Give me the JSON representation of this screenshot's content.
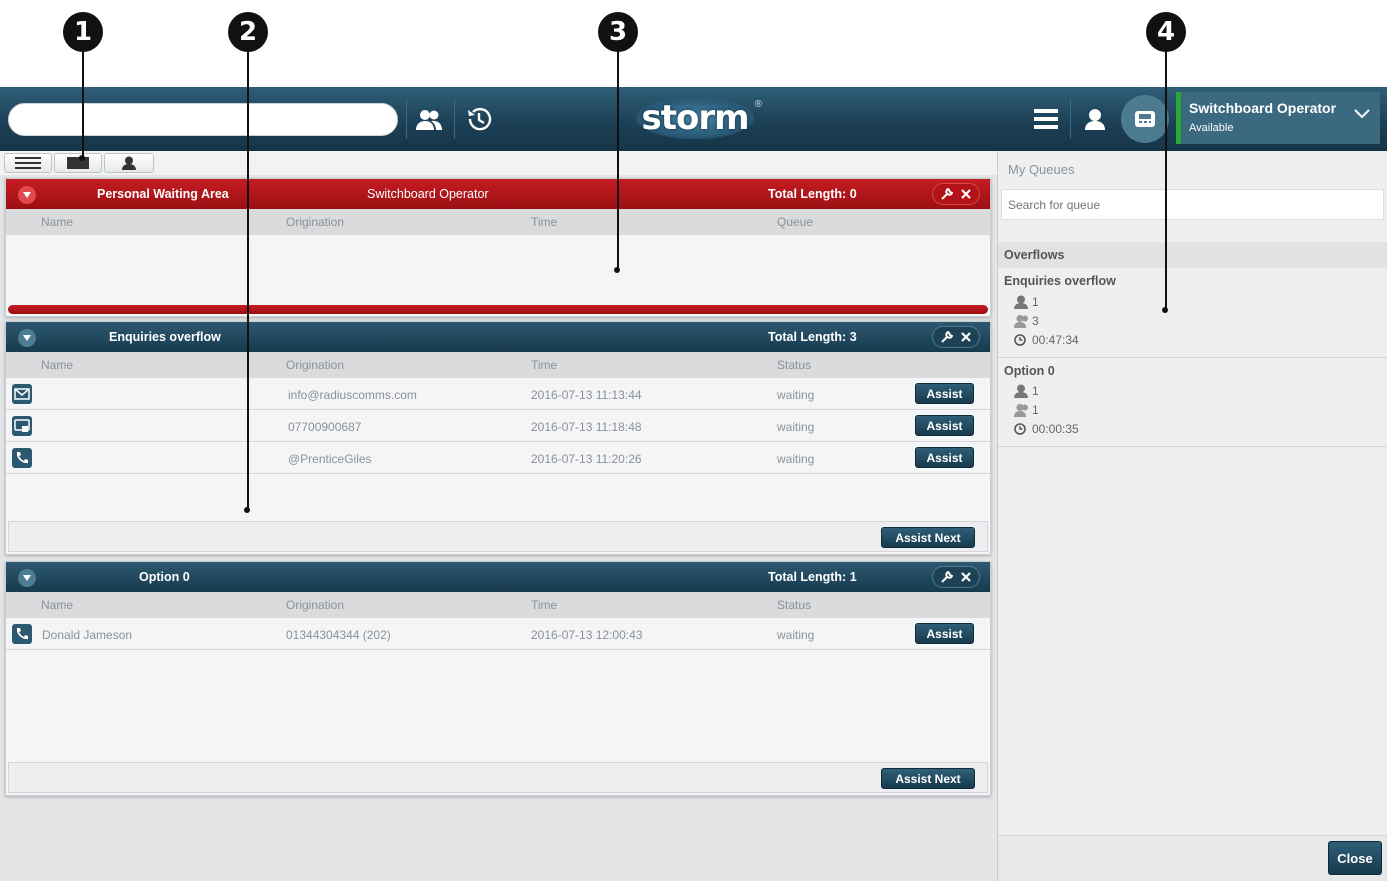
{
  "callouts": [
    "1",
    "2",
    "3",
    "4"
  ],
  "header": {
    "search_value": "",
    "logo_text": "storm",
    "logo_mark": "®",
    "user": {
      "name": "Switchboard Operator",
      "status": "Available",
      "status_color": "#2aa835"
    }
  },
  "panels": {
    "personal": {
      "title": "Personal Waiting Area",
      "owner": "Switchboard Operator",
      "total": "Total Length: 0",
      "columns": [
        "Name",
        "Origination",
        "Time",
        "Queue"
      ]
    },
    "enquiries": {
      "title": "Enquiries overflow",
      "total": "Total Length: 3",
      "columns": [
        "Name",
        "Origination",
        "Time",
        "Status"
      ],
      "rows": [
        {
          "icon": "email-icon",
          "name": "",
          "origination": "info@radiuscomms.com",
          "time": "2016-07-13 11:13:44",
          "status": "waiting",
          "action": "Assist"
        },
        {
          "icon": "chat-icon",
          "name": "",
          "origination": "07700900687",
          "time": "2016-07-13 11:18:48",
          "status": "waiting",
          "action": "Assist"
        },
        {
          "icon": "phone-icon",
          "name": "",
          "origination": "@PrenticeGiles",
          "time": "2016-07-13 11:20:26",
          "status": "waiting",
          "action": "Assist"
        }
      ],
      "footer_button": "Assist Next"
    },
    "option0": {
      "title": "Option 0",
      "total": "Total Length: 1",
      "columns": [
        "Name",
        "Origination",
        "Time",
        "Status"
      ],
      "rows": [
        {
          "icon": "phone-icon",
          "name": "Donald Jameson",
          "origination": "01344304344 (202)",
          "time": "2016-07-13 12:00:43",
          "status": "waiting",
          "action": "Assist"
        }
      ],
      "footer_button": "Assist Next"
    }
  },
  "sidebar": {
    "title": "My Queues",
    "search_placeholder": "Search for queue",
    "section": "Overflows",
    "queues": [
      {
        "name": "Enquiries overflow",
        "agents": "1",
        "waiting": "3",
        "time": "00:47:34"
      },
      {
        "name": "Option 0",
        "agents": "1",
        "waiting": "1",
        "time": "00:00:35"
      }
    ],
    "close_label": "Close"
  },
  "colors": {
    "header": "#1d4157",
    "personal_header": "#b3161b",
    "queue_header": "#1f4458",
    "button": "#1f4458"
  }
}
